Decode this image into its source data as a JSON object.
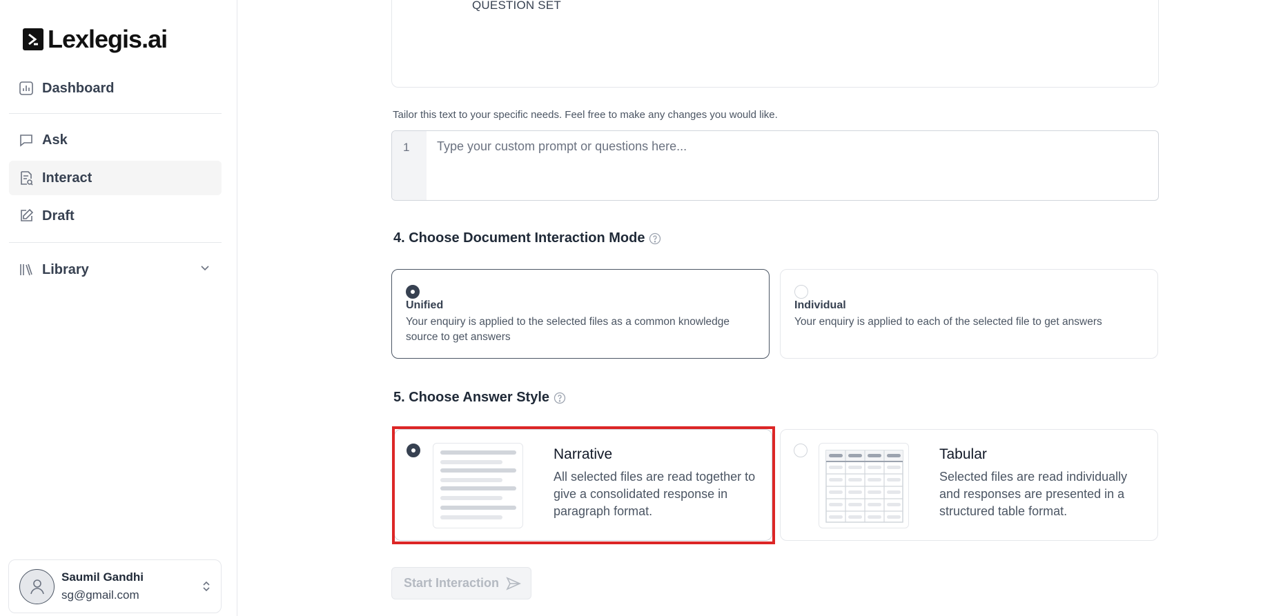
{
  "brand": {
    "logo_text": "Lexlegis.ai"
  },
  "sidebar": {
    "items": [
      {
        "label": "Dashboard",
        "icon": "chart-icon"
      },
      {
        "label": "Ask",
        "icon": "chat-bubble-icon"
      },
      {
        "label": "Interact",
        "icon": "document-search-icon",
        "active": true
      },
      {
        "label": "Draft",
        "icon": "pencil-square-icon"
      },
      {
        "label": "Library",
        "icon": "library-icon",
        "expandable": true
      }
    ],
    "user": {
      "name": "Saumil Gandhi",
      "email": "sg@gmail.com"
    }
  },
  "main": {
    "prev_section_text": "QUESTION SET",
    "prompt_hint": "Tailor this text to your specific needs. Feel free to make any changes you would like.",
    "prompt": {
      "line_number": "1",
      "placeholder": "Type your custom prompt or questions here...",
      "value": ""
    },
    "interaction_mode": {
      "title": "4. Choose Document Interaction Mode",
      "options": [
        {
          "title": "Unified",
          "description": "Your enquiry is applied to the selected files as a common knowledge source to get answers",
          "selected": true
        },
        {
          "title": "Individual",
          "description": "Your enquiry is applied to each of the selected file to get answers",
          "selected": false
        }
      ]
    },
    "answer_style": {
      "title": "5. Choose Answer Style",
      "options": [
        {
          "title": "Narrative",
          "description": "All selected files are read together to give a consolidated response in paragraph format.",
          "selected": true
        },
        {
          "title": "Tabular",
          "description": "Selected files are read individually and responses are presented in a structured table format.",
          "selected": false
        }
      ]
    },
    "start_button": {
      "label": "Start Interaction",
      "enabled": false
    }
  },
  "colors": {
    "highlight": "#dc2626",
    "text": "#1f2937",
    "muted": "#4b5563"
  }
}
